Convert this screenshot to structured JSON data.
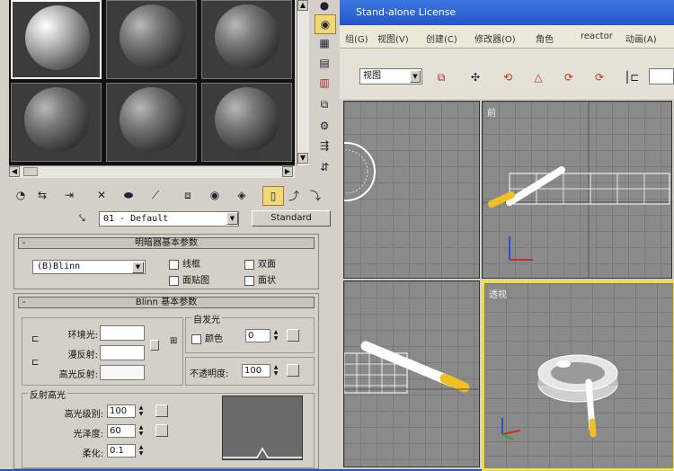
{
  "material_editor": {
    "material_name": "01 - Default",
    "material_type": "Standard",
    "shader_rollout": {
      "title": "明暗器基本参数",
      "shader": "(B)Blinn",
      "options": [
        "线框",
        "双面",
        "面贴图",
        "面状"
      ]
    },
    "blinn_rollout": {
      "title": "Blinn 基本参数",
      "ambient_label": "环境光:",
      "diffuse_label": "漫反射:",
      "specular_label": "高光反射:",
      "self_illum_group": "自发光",
      "color_label": "颜色",
      "color_value": "0",
      "opacity_label": "不透明度:",
      "opacity_value": "100"
    },
    "specular_group": {
      "title": "反射高光",
      "level_label": "高光级别:",
      "level_value": "100",
      "gloss_label": "光泽度:",
      "gloss_value": "60",
      "soften_label": "柔化:",
      "soften_value": "0.1"
    }
  },
  "max_window": {
    "title": "Stand-alone License",
    "menus": [
      "组(G)",
      "视图(V)",
      "创建(C)",
      "修改器(O)",
      "角色",
      "reactor",
      "动画(A)"
    ],
    "view_select": "视图",
    "viewports": [
      {
        "label": ""
      },
      {
        "label": "前"
      },
      {
        "label": ""
      },
      {
        "label": "透视"
      }
    ]
  },
  "colors": {
    "panel": "#d4d0c8",
    "titlebar": "#2456c8",
    "viewport_bg": "#8a8a8a",
    "active_viewport_border": "#f0e040",
    "cigarette_filter": "#f0c020"
  }
}
